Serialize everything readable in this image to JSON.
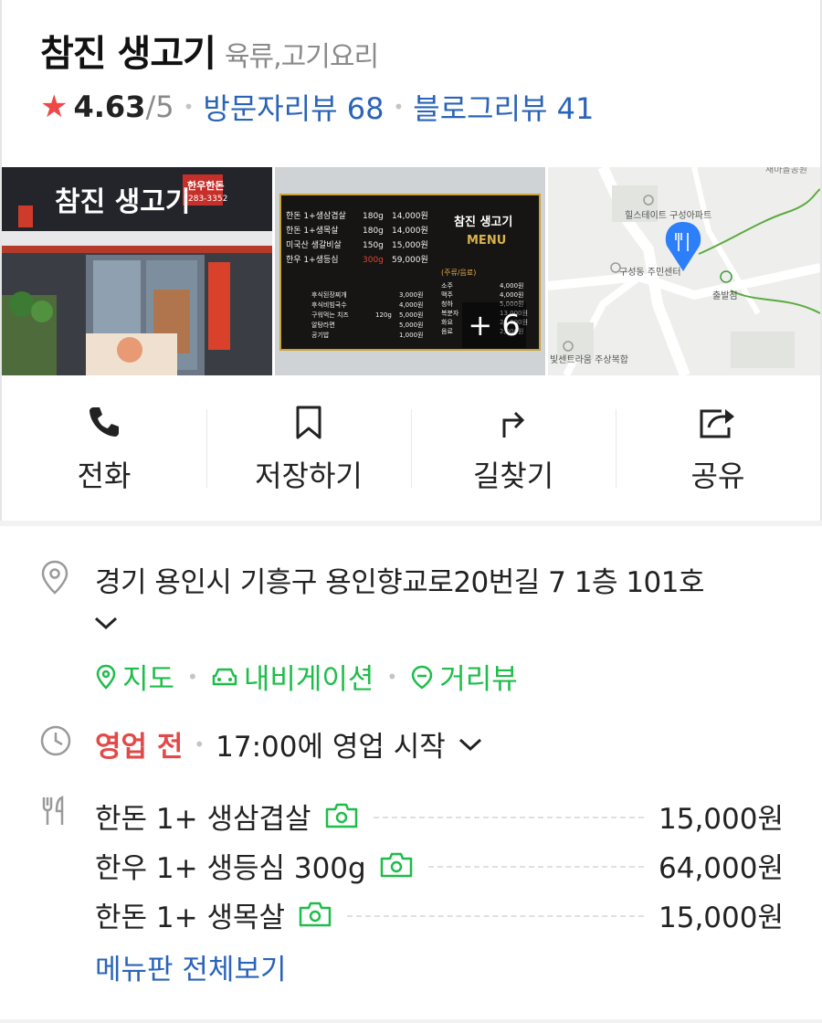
{
  "place": {
    "name": "참진 생고기",
    "category": "육류,고기요리"
  },
  "rating": {
    "score": "4.63",
    "out_of": "/5",
    "visitor_reviews": "방문자리뷰 68",
    "blog_reviews": "블로그리뷰 41"
  },
  "photos": {
    "storefront": {
      "sign_name": "참진 생고기",
      "sign_badge": "한우한돈",
      "sign_phone": "283-3352",
      "banner": "건물뒤편주차장"
    },
    "menu_board": {
      "brand": "참진 생고기",
      "brand_sub": "MENU",
      "items": [
        [
          "한돈 1+생삼겹살",
          "180g",
          "14,000원"
        ],
        [
          "한돈 1+생목살",
          "180g",
          "14,000원"
        ],
        [
          "미국산 생갈비살",
          "150g",
          "15,000원"
        ],
        [
          "한우 1+생등심",
          "300g",
          "59,000원"
        ],
        [
          "후식된장찌개",
          "",
          "3,000원"
        ],
        [
          "후식비빔국수",
          "",
          "4,000원"
        ],
        [
          "구워먹는 치즈",
          "120g",
          "5,000원"
        ],
        [
          "알탕라면",
          "",
          "5,000원"
        ],
        [
          "공기밥",
          "",
          "1,000원"
        ]
      ],
      "drinks_header": "(주류/음료)",
      "drinks": [
        [
          "소주",
          "4,000원"
        ],
        [
          "맥주",
          "4,000원"
        ],
        [
          "청하",
          "5,000원"
        ],
        [
          "복분자",
          "13,000원"
        ],
        [
          "화요",
          "25,000원"
        ],
        [
          "음료",
          "2,000원"
        ]
      ],
      "more_count": "+ 6"
    },
    "map": {
      "labels": [
        "새마을공원",
        "힐스테이트 구성아파트",
        "구성동 주민센터",
        "출발점",
        "빛센트라움 주상복합"
      ]
    }
  },
  "actions": [
    {
      "label": "전화",
      "icon": "phone-icon"
    },
    {
      "label": "저장하기",
      "icon": "bookmark-icon"
    },
    {
      "label": "길찾기",
      "icon": "directions-icon"
    },
    {
      "label": "공유",
      "icon": "share-icon"
    }
  ],
  "address": {
    "text": "경기 용인시 기흥구 용인향교로20번길 7 1층 101호"
  },
  "links": {
    "map": "지도",
    "navigation": "내비게이션",
    "street_view": "거리뷰"
  },
  "hours": {
    "status": "영업 전",
    "detail": "17:00에 영업 시작"
  },
  "menu": {
    "items": [
      {
        "name": "한돈 1+ 생삼겹살",
        "price": "15,000원"
      },
      {
        "name": "한우 1+ 생등심 300g",
        "price": "64,000원"
      },
      {
        "name": "한돈 1+ 생목살",
        "price": "15,000원"
      }
    ],
    "see_all": "메뉴판 전체보기"
  },
  "colors": {
    "accent_green": "#1ebd4a",
    "link_blue": "#2a64b8",
    "closed_red": "#e24a4a",
    "star": "#f04848"
  }
}
